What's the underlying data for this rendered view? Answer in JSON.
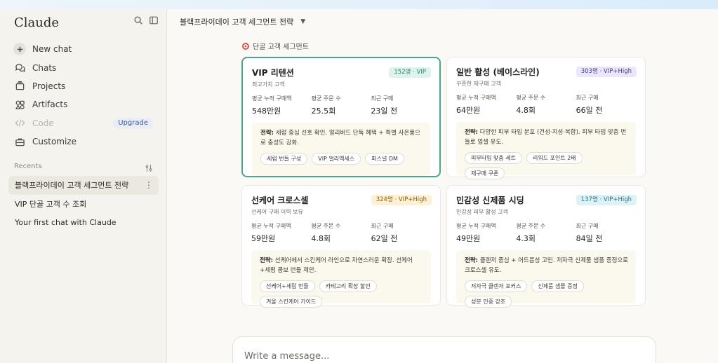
{
  "app": {
    "brand": "Claude"
  },
  "sidebar": {
    "nav": [
      {
        "label": "New chat",
        "icon": "plus-icon"
      },
      {
        "label": "Chats",
        "icon": "chat-bubbles-icon"
      },
      {
        "label": "Projects",
        "icon": "folder-stack-icon"
      },
      {
        "label": "Artifacts",
        "icon": "shapes-icon"
      },
      {
        "label": "Code",
        "icon": "code-icon",
        "badge": "Upgrade",
        "disabled": true
      },
      {
        "label": "Customize",
        "icon": "briefcase-icon"
      }
    ],
    "recents_label": "Recents",
    "recents": [
      {
        "label": "블랙프라이데이 고객 세그먼트 전략",
        "active": true
      },
      {
        "label": "VIP 단골 고객 수 조회"
      },
      {
        "label": "Your first chat with Claude"
      }
    ]
  },
  "conversation": {
    "title": "블랙프라이데이 고객 세그먼트 전략",
    "section_title": "단골 고객 세그먼트",
    "cards": [
      {
        "title": "VIP 리텐션",
        "subtitle": "최고가치 고객",
        "badge": "152명 · VIP",
        "badge_color": "#dff3ee",
        "stats": [
          {
            "label": "평균 누적 구매액",
            "value": "548만원"
          },
          {
            "label": "평균 주문 수",
            "value": "25.5회"
          },
          {
            "label": "최근 구매",
            "value": "23일 전"
          }
        ],
        "strategy_label": "전략:",
        "strategy_text": "세럼 중심 선호 확인. 얼리버드 단독 혜택 + 특별 사은품으로 충성도 강화.",
        "tags": [
          "세럼 번들 구성",
          "VIP 얼리액세스",
          "퍼스널 DM"
        ]
      },
      {
        "title": "일반 활성 (베이스라인)",
        "subtitle": "꾸준한 재구매 고객",
        "badge": "303명 · VIP+High",
        "badge_color": "#ebe6fb",
        "stats": [
          {
            "label": "평균 누적 구매액",
            "value": "64만원"
          },
          {
            "label": "평균 주문 수",
            "value": "4.8회"
          },
          {
            "label": "최근 구매",
            "value": "66일 전"
          }
        ],
        "strategy_label": "전략:",
        "strategy_text": "다양한 피부 타입 분포 (건성·지성·복합). 피부 타입 맞춤 번들로 업셀 유도.",
        "tags": [
          "피부타입 맞춤 세트",
          "리워드 포인트 2배",
          "재구매 쿠폰"
        ]
      },
      {
        "title": "선케어 크로스셀",
        "subtitle": "선케어 구매 이력 보유",
        "badge": "324명 · VIP+High",
        "badge_color": "#fdf0d5",
        "stats": [
          {
            "label": "평균 누적 구매액",
            "value": "59만원"
          },
          {
            "label": "평균 주문 수",
            "value": "4.8회"
          },
          {
            "label": "최근 구매",
            "value": "62일 전"
          }
        ],
        "strategy_label": "전략:",
        "strategy_text": "선케어에서 스킨케어 라인으로 자연스러운 확장. 선케어 +세럼 콤보 번들 제안.",
        "tags": [
          "선케어+세럼 번들",
          "카테고리 확장 할인",
          "겨울 스킨케어 가이드"
        ]
      },
      {
        "title": "민감성 신제품 시딩",
        "subtitle": "민감성 피부 활성 고객",
        "badge": "137명 · VIP+High",
        "badge_color": "#def2f5",
        "stats": [
          {
            "label": "평균 누적 구매액",
            "value": "49만원"
          },
          {
            "label": "평균 주문 수",
            "value": "4.3회"
          },
          {
            "label": "최근 구매",
            "value": "84일 전"
          }
        ],
        "strategy_label": "전략:",
        "strategy_text": "클렌저 중심 + 어드름성 고민. 저자극 신제품 샘플 증정으로 크로스셀 유도.",
        "tags": [
          "저자극 클렌저 포커스",
          "신제품 샘플 증정",
          "성분 인증 강조"
        ]
      }
    ]
  },
  "composer": {
    "placeholder": "Write a message..."
  },
  "colors": {
    "accent": "#4da58e",
    "sidebar_bg": "#f4f3ee",
    "main_bg": "#faf9f5"
  }
}
